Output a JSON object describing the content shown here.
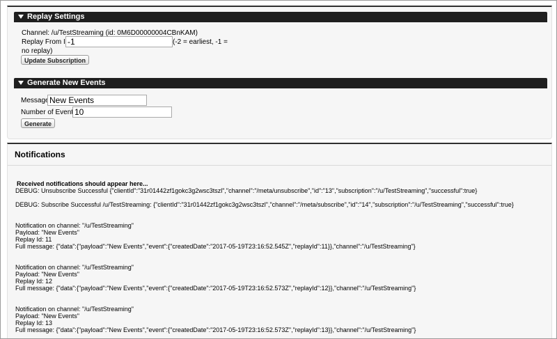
{
  "replay_settings": {
    "header": "Replay Settings",
    "channel_text": "Channel:  /u/TestStreaming  (id:  0M6D00000004CBnKAM)",
    "replay_label": "Replay From Id:",
    "replay_value": "-1",
    "replay_hint_1": "(-2 = earliest, -1 =",
    "replay_hint_2": "no replay)",
    "update_button": "Update Subscription"
  },
  "generate_events": {
    "header": "Generate New Events",
    "message_label": "Message:",
    "message_value": "New Events",
    "count_label": "Number of Events:",
    "count_value": "10",
    "generate_button": "Generate"
  },
  "notifications": {
    "title": "Notifications",
    "intro": "Received notifications should appear here...",
    "debug_unsubscribe": "DEBUG: Unsubscribe Successful {\"clientId\":\"31r01442zf1gokc3g2wsc3tszl\",\"channel\":\"/meta/unsubscribe\",\"id\":\"13\",\"subscription\":\"/u/TestStreaming\",\"successful\":true}",
    "debug_subscribe": "DEBUG: Subscribe Successful /u/TestStreaming: {\"clientId\":\"31r01442zf1gokc3g2wsc3tszl\",\"channel\":\"/meta/subscribe\",\"id\":\"14\",\"subscription\":\"/u/TestStreaming\",\"successful\":true}",
    "events": [
      {
        "channel": "Notification on channel: \"/u/TestStreaming\"",
        "payload": "Payload: \"New Events\"",
        "replay": "Replay Id: 11",
        "full": "Full message: {\"data\":{\"payload\":\"New Events\",\"event\":{\"createdDate\":\"2017-05-19T23:16:52.545Z\",\"replayId\":11}},\"channel\":\"/u/TestStreaming\"}"
      },
      {
        "channel": "Notification on channel: \"/u/TestStreaming\"",
        "payload": "Payload: \"New Events\"",
        "replay": "Replay Id: 12",
        "full": "Full message: {\"data\":{\"payload\":\"New Events\",\"event\":{\"createdDate\":\"2017-05-19T23:16:52.573Z\",\"replayId\":12}},\"channel\":\"/u/TestStreaming\"}"
      },
      {
        "channel": "Notification on channel: \"/u/TestStreaming\"",
        "payload": "Payload: \"New Events\"",
        "replay": "Replay Id: 13",
        "full": "Full message: {\"data\":{\"payload\":\"New Events\",\"event\":{\"createdDate\":\"2017-05-19T23:16:52.573Z\",\"replayId\":13}},\"channel\":\"/u/TestStreaming\"}"
      }
    ]
  }
}
